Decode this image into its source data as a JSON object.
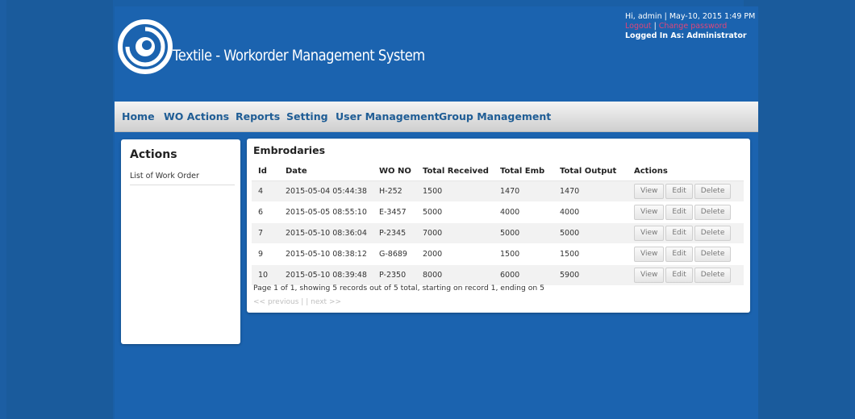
{
  "header": {
    "site_title": "Textile - Workorder Management System",
    "greeting": "Hi, admin | May-10, 2015 1:49 PM",
    "logout": "Logout",
    "change_password": "Change password",
    "logged_in_label": "Logged In As:",
    "logged_in_role": "Administrator"
  },
  "nav": {
    "items": [
      "Home",
      "WO Actions",
      "Reports",
      "Setting",
      "User Management",
      "Group Management"
    ]
  },
  "sidebar": {
    "title": "Actions",
    "items": [
      "List of Work Order"
    ]
  },
  "main": {
    "title": "Embrodaries",
    "columns": [
      "Id",
      "Date",
      "WO NO",
      "Total Received",
      "Total Emb",
      "Total Output",
      "Actions"
    ],
    "rows": [
      [
        "4",
        "2015-05-04 05:44:38",
        "H-252",
        "1500",
        "1470",
        "1470"
      ],
      [
        "6",
        "2015-05-05 08:55:10",
        "E-3457",
        "5000",
        "4000",
        "4000"
      ],
      [
        "7",
        "2015-05-10 08:36:04",
        "P-2345",
        "7000",
        "5000",
        "5000"
      ],
      [
        "9",
        "2015-05-10 08:38:12",
        "G-8689",
        "2000",
        "1500",
        "1500"
      ],
      [
        "10",
        "2015-05-10 08:39:48",
        "P-2350",
        "8000",
        "6000",
        "5900"
      ]
    ],
    "actions": {
      "view": "View",
      "edit": "Edit",
      "delete": "Delete"
    },
    "pagination_text": "Page 1 of 1, showing 5 records out of 5 total, starting on record 1, ending on 5",
    "prev_link": "<< previous",
    "separator": "|",
    "next_link": "next >>"
  },
  "colors": {
    "background": "#1b63af",
    "nav_text": "#1f5d95",
    "link_accent": "#e0457a"
  },
  "icons": {
    "logo": "swirl-logo-icon"
  }
}
